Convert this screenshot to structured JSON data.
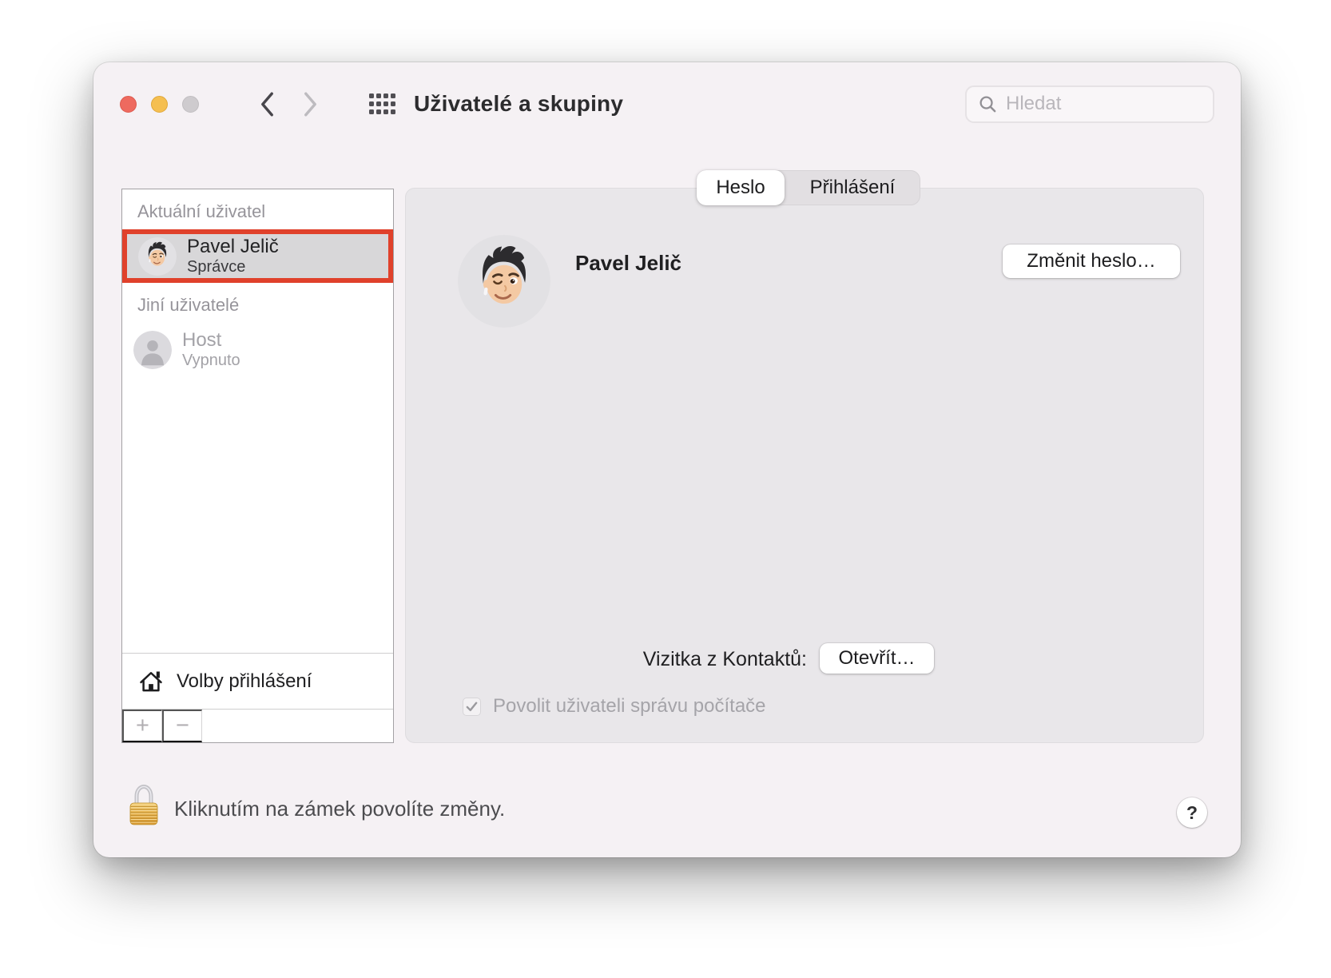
{
  "titlebar": {
    "title": "Uživatelé a skupiny",
    "search_placeholder": "Hledat"
  },
  "sidebar": {
    "current_section_header": "Aktuální uživatel",
    "current_user": {
      "name": "Pavel Jelič",
      "role": "Správce"
    },
    "others_section_header": "Jiní uživatelé",
    "other_users": [
      {
        "name": "Host",
        "status": "Vypnuto"
      }
    ],
    "login_options_label": "Volby přihlášení",
    "add": "+",
    "remove": "−"
  },
  "tabs": [
    {
      "label": "Heslo",
      "selected": true
    },
    {
      "label": "Přihlášení",
      "selected": false
    }
  ],
  "content": {
    "user_name": "Pavel Jelič",
    "change_password_button": "Změnit heslo…",
    "contacts_card_label": "Vizitka z Kontaktů:",
    "open_button": "Otevřít…",
    "allow_admin_label": "Povolit uživateli správu počítače",
    "allow_admin_checked": true
  },
  "footer": {
    "lock_message": "Kliknutím na zámek povolíte změny.",
    "help": "?"
  },
  "colors": {
    "selection_annotation": "#e0412b",
    "traffic_red": "#ee6a5f",
    "traffic_yellow": "#f5bf50",
    "traffic_disabled": "#cecbce",
    "window_bg": "#f5f1f4",
    "panel_bg": "#e9e7ea"
  }
}
